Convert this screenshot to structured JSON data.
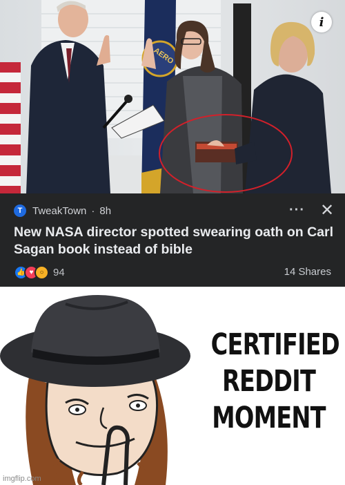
{
  "photo": {
    "alt": "",
    "info_icon": "info-icon",
    "info_glyph": "i",
    "flag_text": "AERO"
  },
  "post": {
    "source": "TweakTown",
    "separator": "·",
    "time": "8h",
    "more_glyph": "···",
    "close_glyph": "✕",
    "headline": "New NASA director spotted swearing oath on Carl Sagan book instead of bible",
    "reactions": [
      "like",
      "love",
      "wow"
    ],
    "reaction_count": "94",
    "shares": "14 Shares",
    "colors": {
      "background": "#242526",
      "text": "#e4e6eb"
    }
  },
  "meme": {
    "caption_lines": [
      "CERTIFIED",
      "REDDIT",
      "MOMENT"
    ]
  },
  "watermark": "imgflip.com"
}
